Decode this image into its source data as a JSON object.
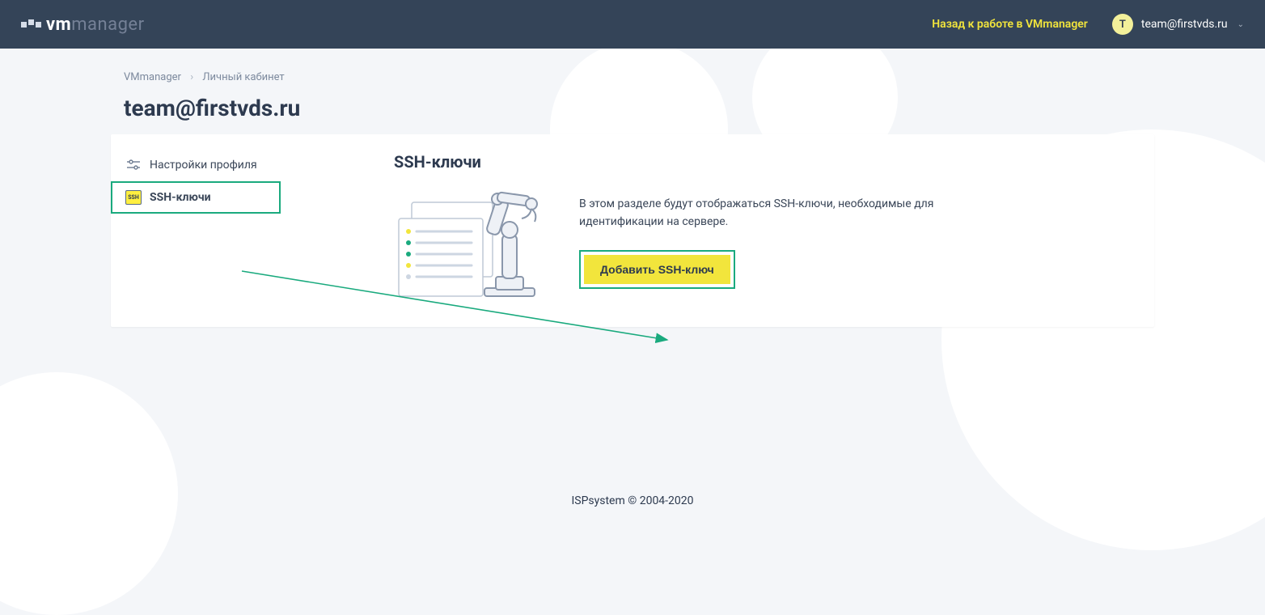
{
  "header": {
    "logo_bold": "vm",
    "logo_light": "manager",
    "back_link": "Назад к работе в VMmanager",
    "avatar_initial": "T",
    "user_email": "team@firstvds.ru"
  },
  "breadcrumb": {
    "root": "VMmanager",
    "current": "Личный кабинет",
    "separator": "›"
  },
  "title": "team@firstvds.ru",
  "sidebar": {
    "profile_settings": "Настройки профиля",
    "ssh_keys": "SSH-ключи",
    "ssh_badge": "SSH"
  },
  "content": {
    "heading": "SSH-ключи",
    "description": "В этом разделе будут отображаться SSH-ключи, необходимые для идентификации на сервере.",
    "add_button": "Добавить SSH-ключ"
  },
  "footer": "ISPsystem © 2004-2020"
}
